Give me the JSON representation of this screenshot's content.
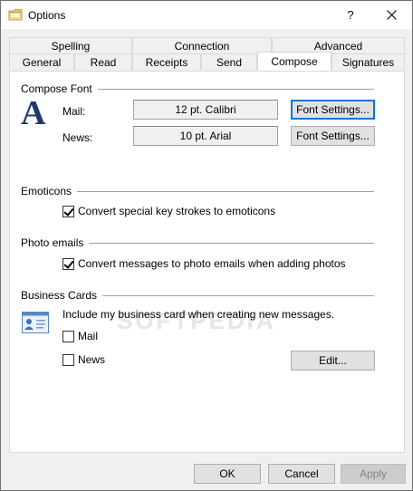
{
  "window": {
    "title": "Options",
    "help": "?",
    "close": "✕"
  },
  "tabs_back": [
    "Spelling",
    "Connection",
    "Advanced"
  ],
  "tabs_front": [
    "General",
    "Read",
    "Receipts",
    "Send",
    "Compose",
    "Signatures"
  ],
  "active_tab": "Compose",
  "compose_font": {
    "section": "Compose Font",
    "mail_label": "Mail:",
    "mail_font": "12 pt. Calibri",
    "news_label": "News:",
    "news_font": "10 pt. Arial",
    "font_settings": "Font Settings..."
  },
  "emoticons": {
    "section": "Emoticons",
    "checkbox": "Convert special key strokes to emoticons",
    "checked": true
  },
  "photo_emails": {
    "section": "Photo emails",
    "checkbox": "Convert messages to photo emails when adding photos",
    "checked": true
  },
  "business_cards": {
    "section": "Business Cards",
    "description": "Include my business card when creating new messages.",
    "mail": "Mail",
    "mail_checked": false,
    "news": "News",
    "news_checked": false,
    "edit": "Edit..."
  },
  "buttons": {
    "ok": "OK",
    "cancel": "Cancel",
    "apply": "Apply"
  },
  "watermark": "SOFTPEDIA"
}
